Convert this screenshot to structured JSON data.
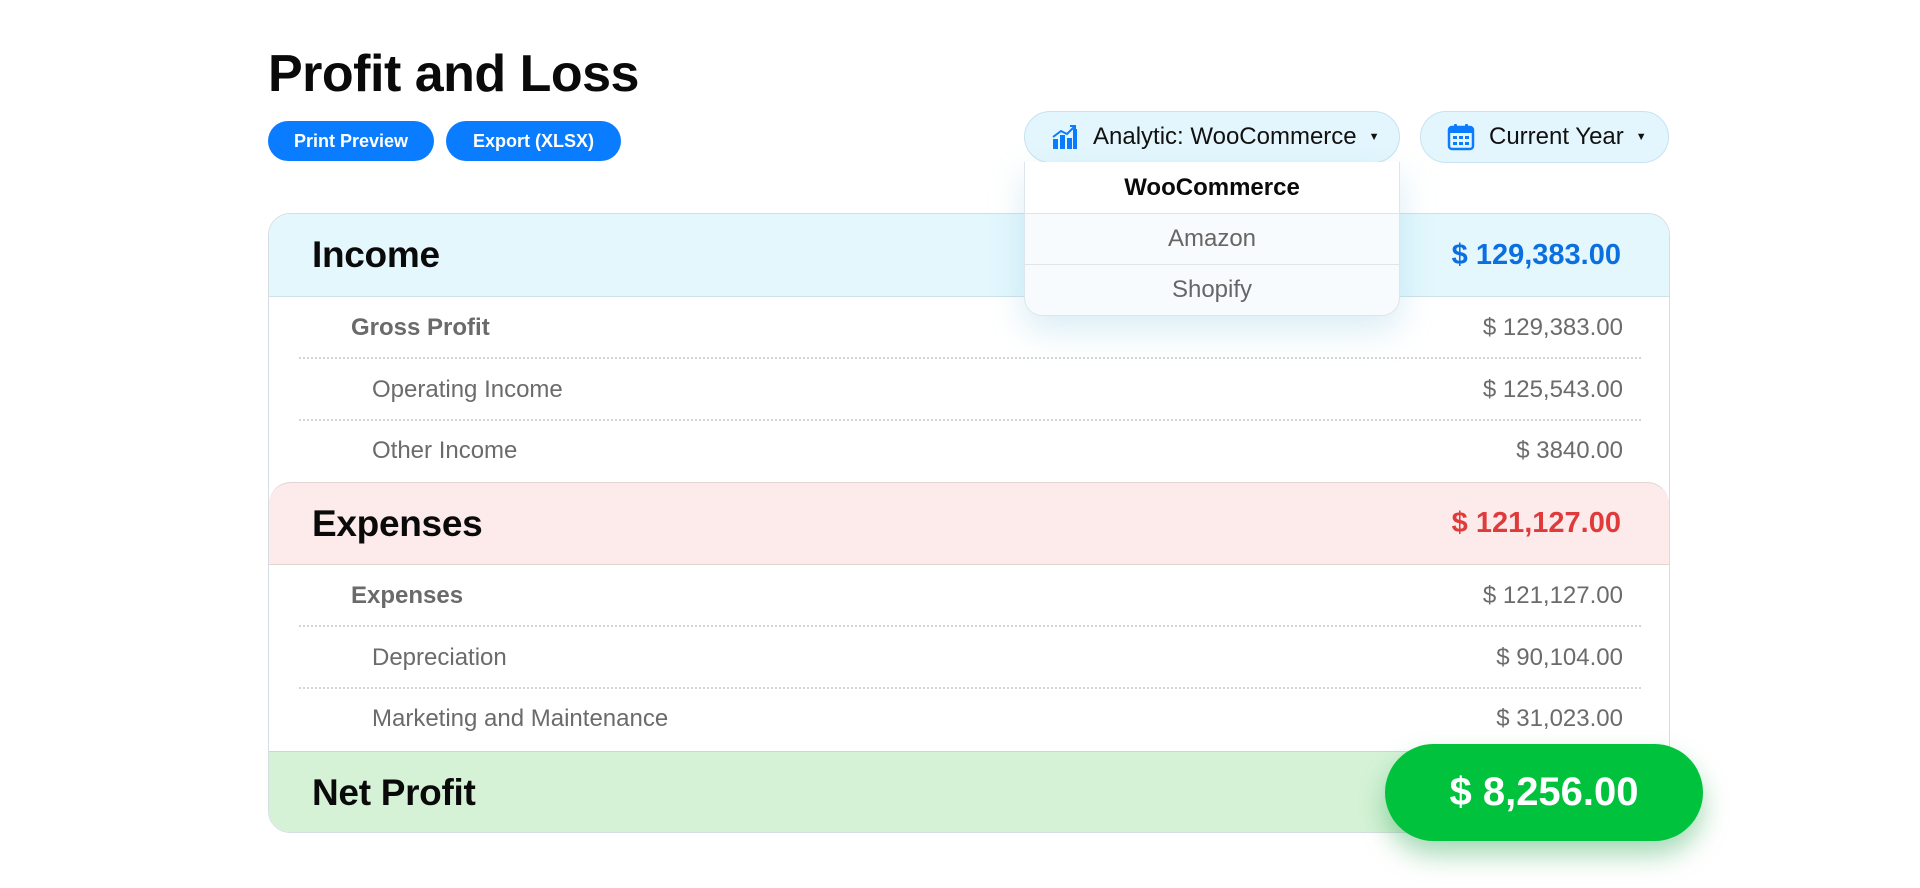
{
  "title": "Profit and Loss",
  "actions": {
    "print_label": "Print Preview",
    "export_label": "Export (XLSX)"
  },
  "analytic_selector": {
    "icon": "bar-chart-icon",
    "label": "Analytic: WooCommerce",
    "options": [
      "WooCommerce",
      "Amazon",
      "Shopify"
    ],
    "selected": "WooCommerce"
  },
  "period_selector": {
    "icon": "calendar-icon",
    "label": "Current Year"
  },
  "income": {
    "label": "Income",
    "total": "$ 129,383.00",
    "rows": [
      {
        "label": "Gross Profit",
        "amount": "$ 129,383.00",
        "level": "group"
      },
      {
        "label": "Operating Income",
        "amount": "$ 125,543.00",
        "level": "item"
      },
      {
        "label": "Other Income",
        "amount": "$ 3840.00",
        "level": "item"
      }
    ]
  },
  "expenses": {
    "label": "Expenses",
    "total": "$ 121,127.00",
    "rows": [
      {
        "label": "Expenses",
        "amount": "$ 121,127.00",
        "level": "group"
      },
      {
        "label": "Depreciation",
        "amount": "$ 90,104.00",
        "level": "item"
      },
      {
        "label": "Marketing and Maintenance",
        "amount": "$ 31,023.00",
        "level": "item"
      }
    ]
  },
  "net_profit": {
    "label": "Net Profit",
    "total": "$ 8,256.00"
  },
  "colors": {
    "primary": "#0a7cff",
    "income_bg": "#e3f7fd",
    "income_text": "#0b6fe0",
    "expense_bg": "#fdebeb",
    "expense_text": "#e03b3b",
    "net_bg": "#d5f2d7",
    "net_badge": "#00c23c"
  }
}
